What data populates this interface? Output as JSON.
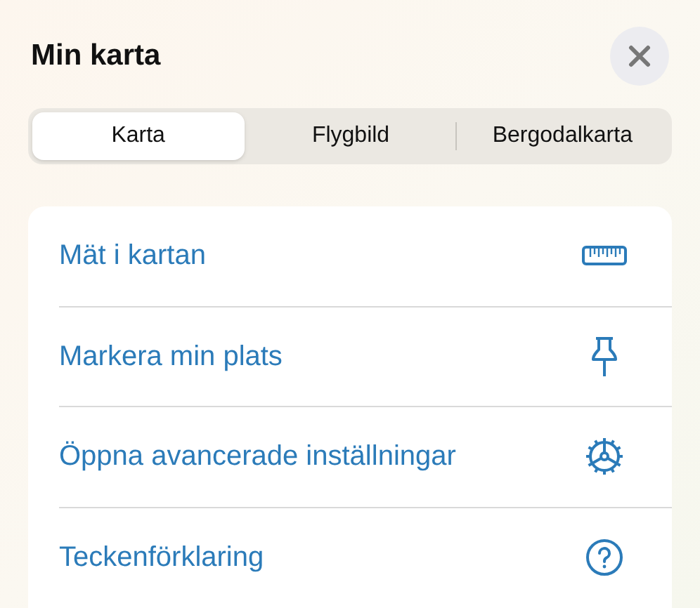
{
  "title": "Min karta",
  "tabs": [
    {
      "label": "Karta",
      "selected": true
    },
    {
      "label": "Flygbild",
      "selected": false
    },
    {
      "label": "Bergodalkarta",
      "selected": false
    }
  ],
  "menu": [
    {
      "label": "Mät i kartan",
      "kind": "ruler"
    },
    {
      "label": "Markera min plats",
      "kind": "pin"
    },
    {
      "label": "Öppna avancerade inställningar",
      "kind": "gear"
    },
    {
      "label": "Teckenförklaring",
      "kind": "help"
    }
  ]
}
